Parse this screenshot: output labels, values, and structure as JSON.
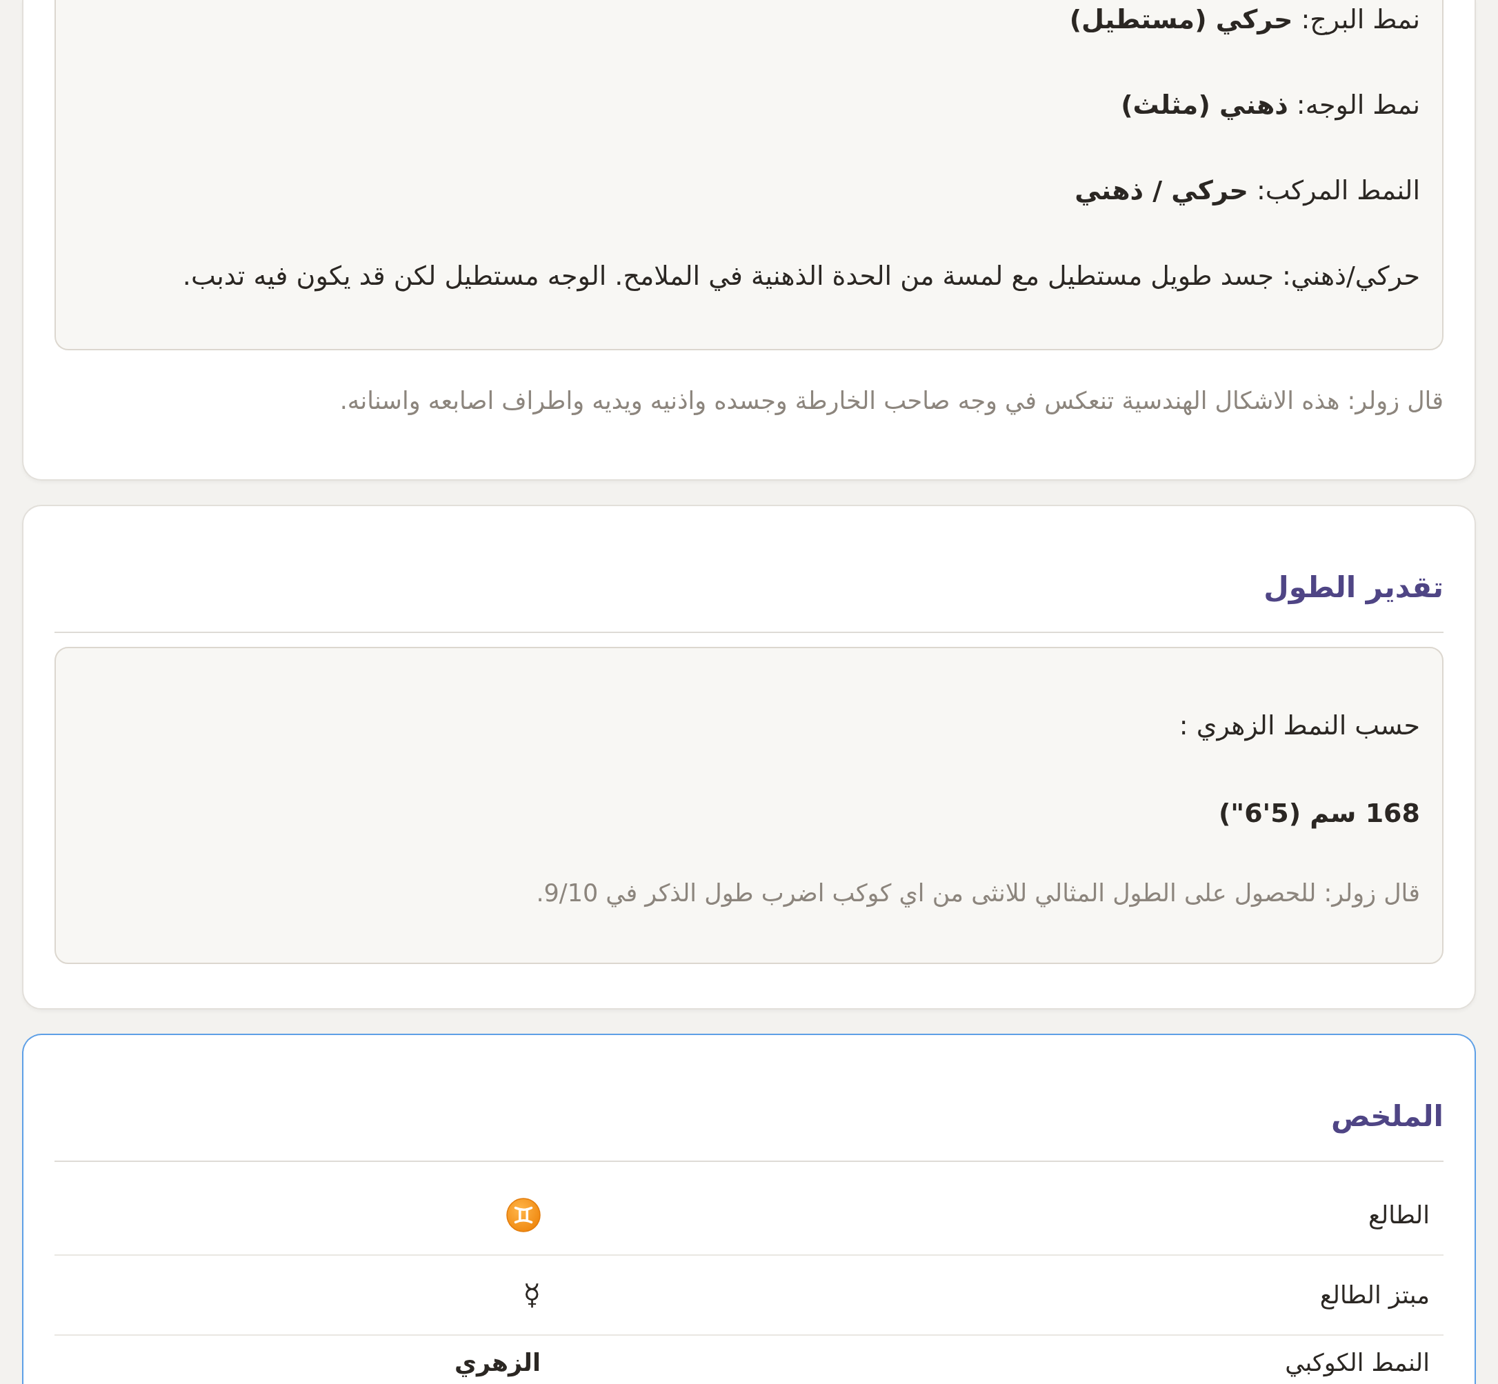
{
  "sections": [
    {
      "highlighted": false,
      "box": {
        "lines": [
          {
            "kind": "text",
            "text": "نمط البرج: **حركي (مستطيل)**"
          },
          {
            "kind": "text",
            "text": "نمط الوجه: **ذهني (مثلث)**"
          },
          {
            "kind": "text",
            "text": "النمط المركب: **حركي / ذهني**"
          },
          {
            "kind": "text",
            "text": "حركي/ذهني: جسد طويل مستطيل مع لمسة من الحدة الذهنية في الملامح. الوجه مستطيل لكن قد يكون فيه تدبب."
          }
        ]
      },
      "note": "قال زولر: هذه الاشكال الهندسية تنعكس في وجه صاحب الخارطة وجسده واذنيه ويديه واطراف اصابعه واسنانه."
    },
    {
      "highlighted": false,
      "title": "تقدير الطول",
      "box": {
        "lines": [
          {
            "kind": "text",
            "text": "حسب النمط الزهري :"
          },
          {
            "kind": "figure",
            "text": "168 سم (5'6\")"
          },
          {
            "kind": "note",
            "text": "قال زولر: للحصول على الطول المثالي للانثى من اي كوكب اضرب طول الذكر في 9/10."
          }
        ]
      }
    },
    {
      "highlighted": true,
      "title": "الملخص",
      "rows": [
        {
          "label": "الطالع",
          "kind": "icon"
        },
        {
          "label": "مبتز الطالع",
          "kind": "symbol",
          "value": "☿"
        },
        {
          "label": "النمط الكوكبي",
          "kind": "text",
          "value": "الزهري"
        }
      ]
    }
  ]
}
